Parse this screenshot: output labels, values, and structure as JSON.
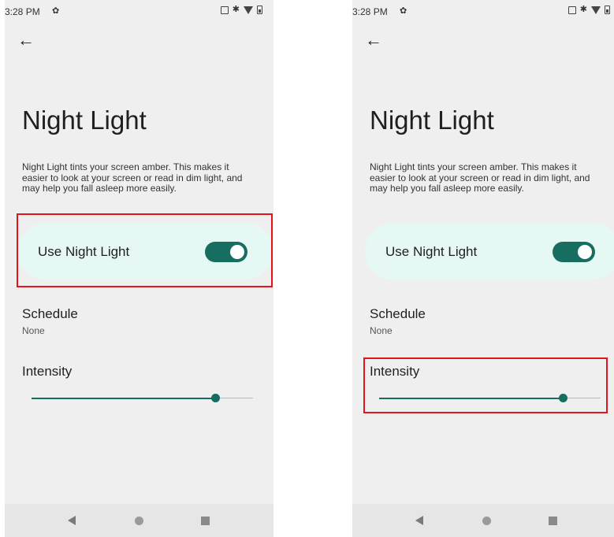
{
  "status_bar": {
    "time": "3:28 PM",
    "icons": [
      "gear-icon",
      "sim-icon",
      "bluetooth-icon",
      "wifi-icon",
      "battery-icon"
    ]
  },
  "header": {
    "back_icon": "arrow-left-icon"
  },
  "title": "Night Light",
  "description": "Night Light tints your screen amber. This makes it easier to look at your screen or read in dim light, and may help you fall asleep more easily.",
  "toggle": {
    "label": "Use Night Light",
    "on": true
  },
  "schedule": {
    "title": "Schedule",
    "value": "None"
  },
  "intensity": {
    "title": "Intensity",
    "level": 0.83
  },
  "nav_bar": {
    "icons": [
      "nav-back-icon",
      "nav-home-icon",
      "nav-recents-icon"
    ]
  },
  "colors": {
    "accent": "#176d5f",
    "card": "#e5f8f4",
    "highlight": "#e3141c",
    "background": "#efefef"
  },
  "highlights": {
    "left_screen": "toggle-card",
    "right_screen": "intensity-slider"
  }
}
